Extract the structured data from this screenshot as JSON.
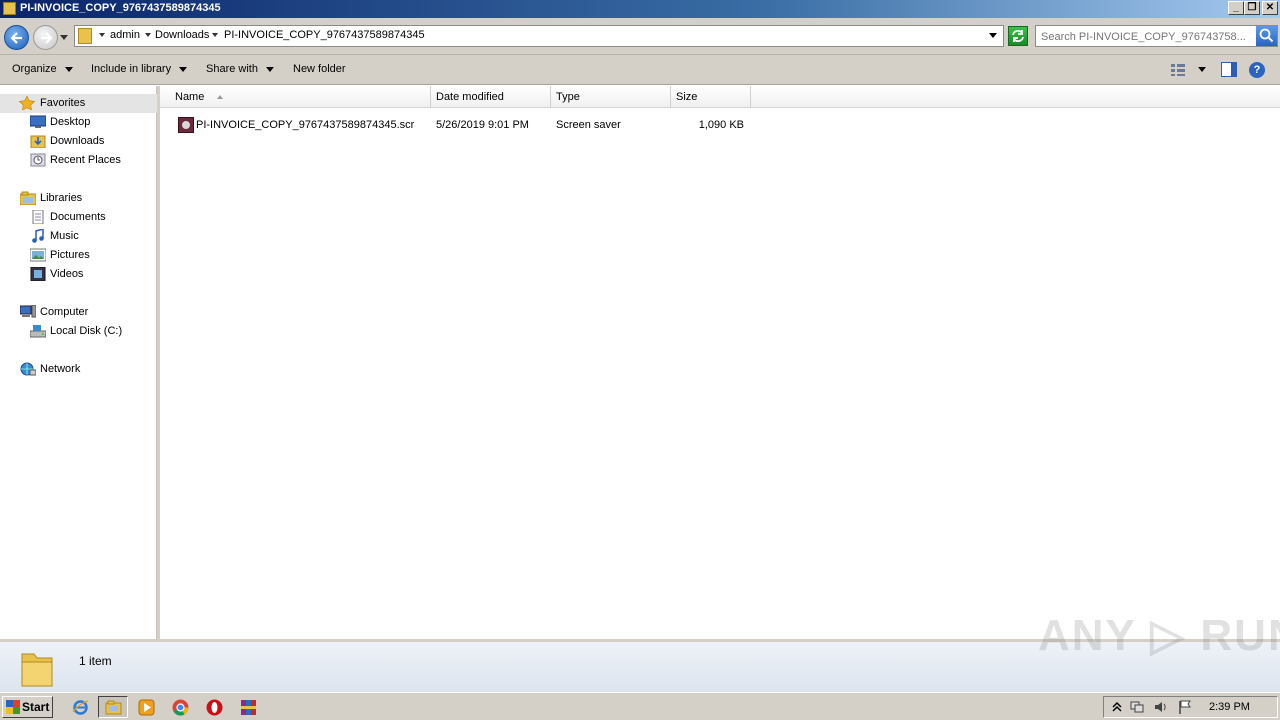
{
  "window": {
    "title": "PI-INVOICE_COPY_9767437589874345",
    "buttons": {
      "minimize": "_",
      "restore": "❐",
      "close": "✕"
    }
  },
  "address": {
    "crumbs": [
      "admin",
      "Downloads",
      "PI-INVOICE_COPY_9767437589874345"
    ]
  },
  "search": {
    "placeholder": "Search PI-INVOICE_COPY_976743758..."
  },
  "toolbar": {
    "organize": "Organize",
    "include_in_library": "Include in library",
    "share_with": "Share with",
    "new_folder": "New folder",
    "help": "?"
  },
  "nav": {
    "favorites": "Favorites",
    "desktop": "Desktop",
    "downloads": "Downloads",
    "recent_places": "Recent Places",
    "libraries": "Libraries",
    "documents": "Documents",
    "music": "Music",
    "pictures": "Pictures",
    "videos": "Videos",
    "computer": "Computer",
    "local_disk": "Local Disk (C:)",
    "network": "Network"
  },
  "columns": {
    "name": "Name",
    "date_modified": "Date modified",
    "type": "Type",
    "size": "Size"
  },
  "files": [
    {
      "name": "PI-INVOICE_COPY_9767437589874345.scr",
      "date_modified": "5/26/2019 9:01 PM",
      "type": "Screen saver",
      "size": "1,090 KB"
    }
  ],
  "details": {
    "item_count": "1 item"
  },
  "watermark": "ANY ▷ RUN",
  "taskbar": {
    "start": "Start",
    "clock": "2:39 PM"
  },
  "colors": {
    "title_gradient_start": "#0a246a",
    "chrome": "#d4d0c8",
    "selection": "#e4e4e4"
  }
}
